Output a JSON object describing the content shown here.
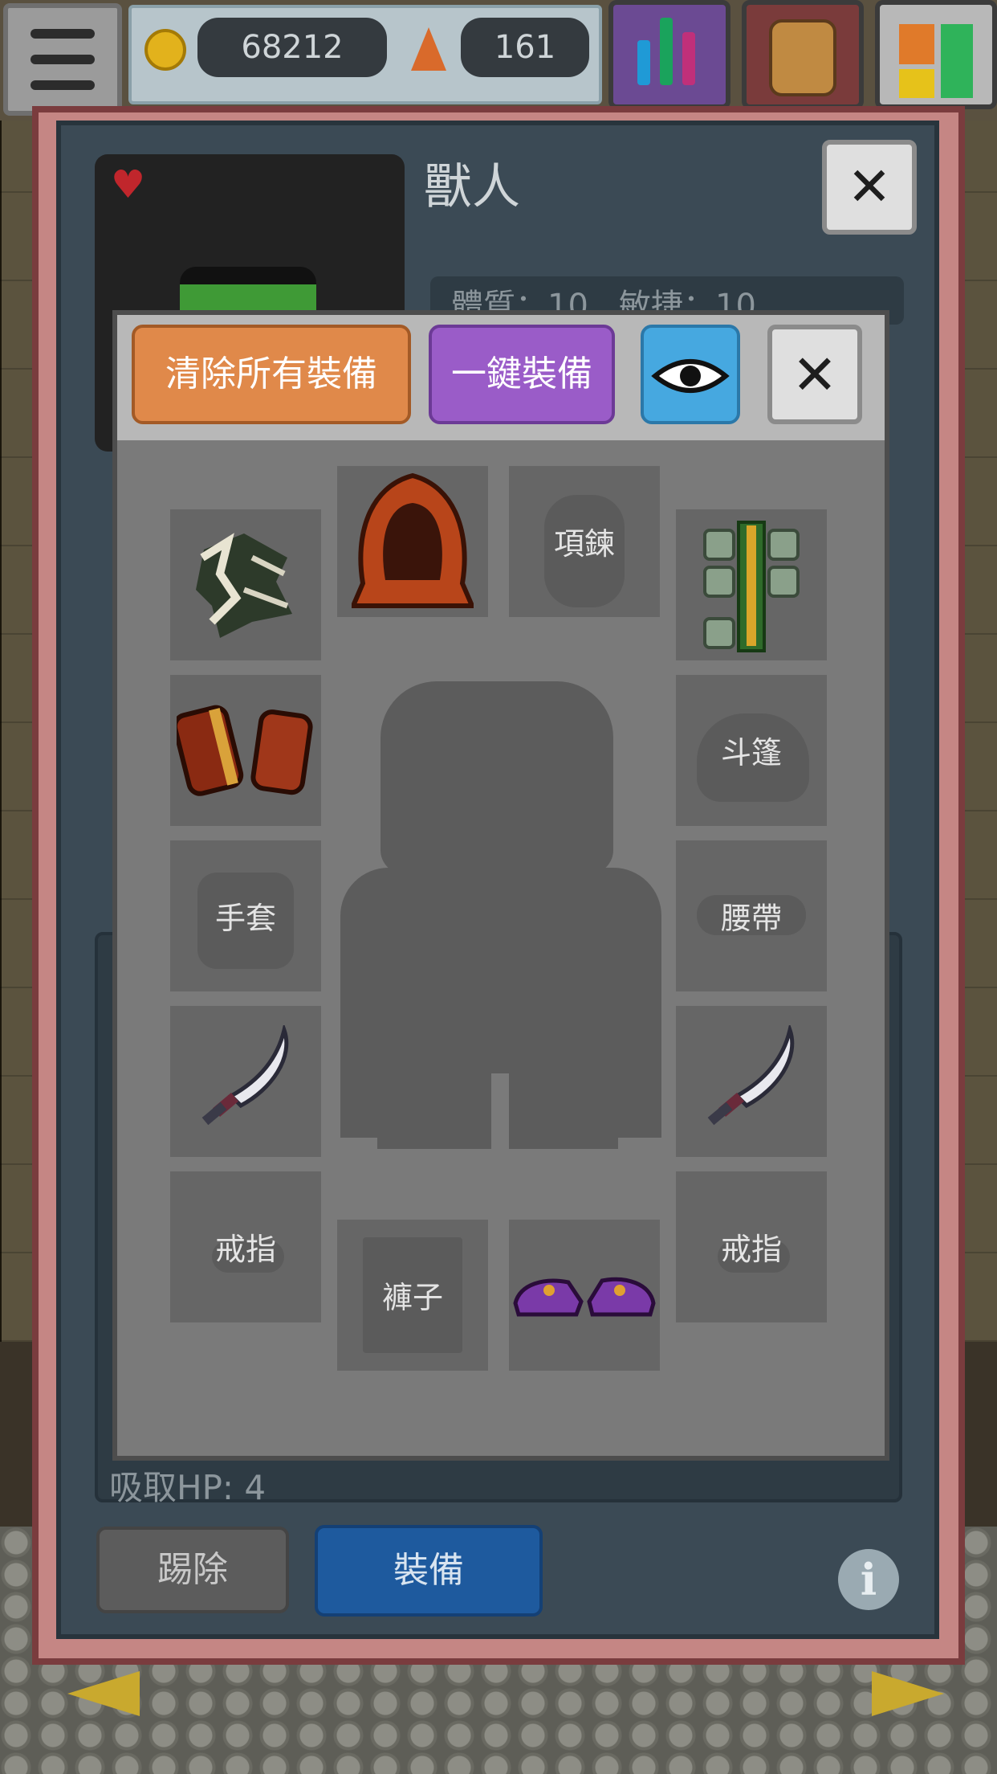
{
  "hud": {
    "coins": "68212",
    "crystals": "161",
    "stats_bar_colors": [
      "#1f9ad6",
      "#1aa35c",
      "#c0307a"
    ],
    "quick_colors": [
      "#e07a2a",
      "#e6c21a",
      "#2fb35a"
    ]
  },
  "panel": {
    "character_name": "獸人",
    "stat_partial": "體質：10   敏捷：10",
    "absorb_hp": "吸取HP: 4",
    "kick_label": "踢除",
    "equip_label": "裝備",
    "info_glyph": "i",
    "close_glyph": "✕"
  },
  "equip_popup": {
    "clear_all_label": "清除所有裝備",
    "one_click_label": "一鍵裝備",
    "close_glyph": "✕",
    "slots": {
      "weapon_top": {
        "label": "",
        "item": "bone-claw-weapon"
      },
      "helmet": {
        "label": "",
        "item": "red-hood"
      },
      "necklace": {
        "label": "項鍊",
        "item": ""
      },
      "armor": {
        "label": "",
        "item": "green-plate-armor"
      },
      "bracers": {
        "label": "",
        "item": "leather-bracers"
      },
      "cloak": {
        "label": "斗篷",
        "item": ""
      },
      "gloves": {
        "label": "手套",
        "item": ""
      },
      "belt": {
        "label": "腰帶",
        "item": ""
      },
      "left_hand": {
        "label": "",
        "item": "curved-dagger"
      },
      "right_hand": {
        "label": "",
        "item": "curved-dagger"
      },
      "ring_left": {
        "label": "戒指",
        "item": ""
      },
      "pants": {
        "label": "褲子",
        "item": ""
      },
      "boots": {
        "label": "",
        "item": "purple-shoes"
      },
      "ring_right": {
        "label": "戒指",
        "item": ""
      }
    }
  }
}
